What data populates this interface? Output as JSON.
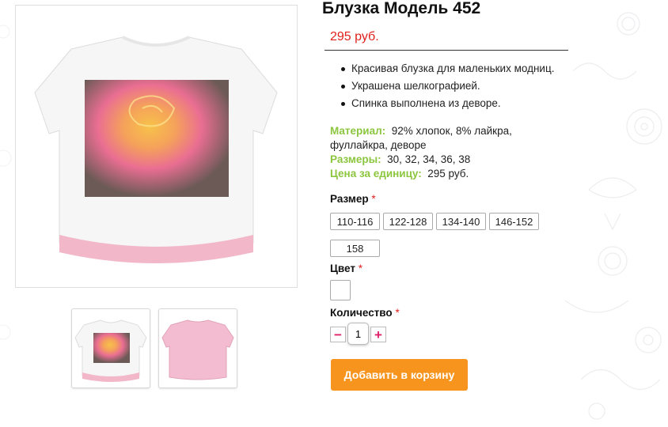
{
  "product": {
    "title": "Блузка Модель 452",
    "price": "295 руб.",
    "features": [
      "Красивая блузка для маленьких модниц.",
      "Украшена шелкографией.",
      "Спинка выполнена из деворе."
    ],
    "specs": {
      "material_label": "Материал:",
      "material_value": "92% хлопок, 8% лайкра, фуллайкра, деворе",
      "sizes_label": "Размеры:",
      "sizes_value": "30, 32, 34, 36, 38",
      "unit_price_label": "Цена за единицу:",
      "unit_price_value": "295 руб."
    }
  },
  "options": {
    "size_label": "Размер",
    "size_required": "*",
    "sizes": [
      "110-116",
      "122-128",
      "134-140",
      "146-152",
      "158"
    ],
    "color_label": "Цвет",
    "color_required": "*",
    "quantity_label": "Количество",
    "quantity_required": "*",
    "quantity_value": "1",
    "minus_symbol": "−",
    "plus_symbol": "+"
  },
  "actions": {
    "add_to_cart": "Добавить в корзину"
  },
  "colors": {
    "price": "#e0201d",
    "spec_label": "#8cc63f",
    "cart_button": "#f7941d",
    "qty_symbol": "#e0206a"
  }
}
